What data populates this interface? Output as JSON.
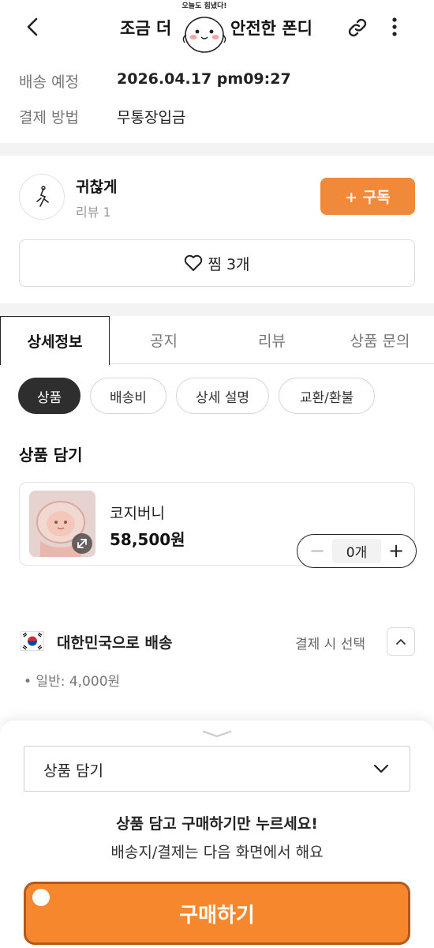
{
  "header": {
    "title_left": "조금 더",
    "title_right": "안전한 폰디",
    "mascot_text": "오늘도 힘냈다!"
  },
  "info": {
    "delivery_label": "배송 예정",
    "delivery_value": "2026.04.17 pm09:27",
    "payment_label": "결제 방법",
    "payment_value": "무통장입금"
  },
  "seller": {
    "name": "귀찮게",
    "review": "리뷰 1",
    "subscribe_label": "+ 구독",
    "wish_label": "찜 3개"
  },
  "tabs": [
    "상세정보",
    "공지",
    "리뷰",
    "상품 문의"
  ],
  "chips": [
    "상품",
    "배송비",
    "상세 설명",
    "교환/환불"
  ],
  "product_section": {
    "title": "상품 담기",
    "product_name": "코지버니",
    "product_price": "58,500원",
    "quantity": "0개"
  },
  "shipping": {
    "destination": "대한민국으로 배송",
    "select_label": "결제 시 선택",
    "fee": "• 일반: 4,000원"
  },
  "sheet": {
    "select_label": "상품 담기",
    "message_main": "상품 담고 구매하기만 누르세요!",
    "message_sub": "배송지/결제는 다음 화면에서 해요",
    "buy_label": "구매하기"
  },
  "colors": {
    "accent": "#f08a3a",
    "buy": "#f7872c",
    "chip_active": "#2e2e2e"
  }
}
